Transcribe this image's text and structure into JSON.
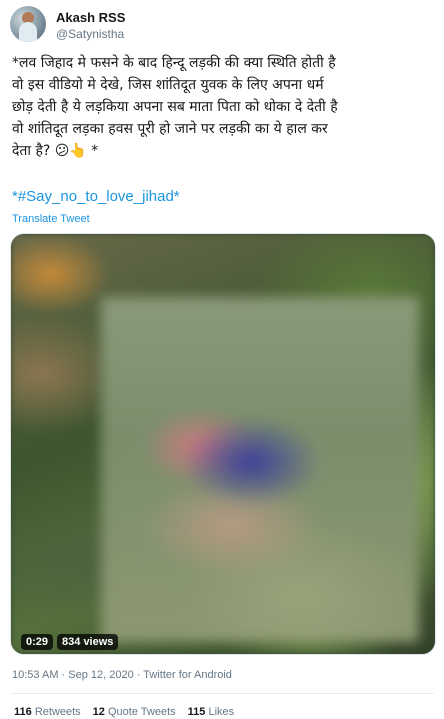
{
  "author": {
    "name": "Akash RSS",
    "handle": "@Satynistha"
  },
  "tweet": {
    "text": "*लव जिहाद मे फसने के बाद हिन्दू लड़की की क्या स्थिति होती है\nवो इस वीडियो मे देखे, जिस शांतिदूत युवक के लिए अपना धर्म\nछोड़ देती है ये लड़किया अपना सब माता पिता को धोका दे देती है\nवो शांतिदूत लड़का हवस पूरी हो जाने पर लड़की का ये हाल कर\nदेता है? 😕👆 *",
    "hashtag": "*#Say_no_to_love_jihad*",
    "translate_label": "Translate Tweet"
  },
  "video": {
    "duration": "0:29",
    "views": "834 views"
  },
  "meta": "10:53 AM · Sep 12, 2020 · Twitter for Android",
  "stats": {
    "retweets_count": "116",
    "retweets_label": "Retweets",
    "quotes_count": "12",
    "quotes_label": "Quote Tweets",
    "likes_count": "115",
    "likes_label": "Likes"
  },
  "colors": {
    "link": "#1b95e0",
    "secondary_text": "#657786",
    "primary_text": "#14171a"
  }
}
